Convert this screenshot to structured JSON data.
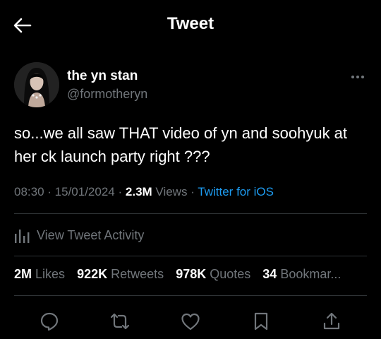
{
  "header": {
    "title": "Tweet",
    "back_icon": "arrow-left-icon"
  },
  "author": {
    "display_name": "the yn stan",
    "handle": "@formotheryn"
  },
  "tweet": {
    "text": "so...we all saw THAT video of yn and soohyuk at her ck launch party right ???"
  },
  "meta": {
    "time": "08:30",
    "date": "15/01/2024",
    "views_count": "2.3M",
    "views_label": "Views",
    "source": "Twitter for iOS"
  },
  "activity": {
    "label": "View Tweet Activity",
    "icon": "bar-chart-icon"
  },
  "stats": [
    {
      "count": "2M",
      "label": "Likes"
    },
    {
      "count": "922K",
      "label": "Retweets"
    },
    {
      "count": "978K",
      "label": "Quotes"
    },
    {
      "count": "34",
      "label": "Bookmar..."
    }
  ],
  "actions": [
    "reply-icon",
    "retweet-icon",
    "like-icon",
    "bookmark-icon",
    "share-icon"
  ],
  "colors": {
    "background": "#000000",
    "text": "#e7e9ea",
    "muted": "#71767b",
    "link": "#1d9bf0",
    "divider": "#2f3336"
  }
}
